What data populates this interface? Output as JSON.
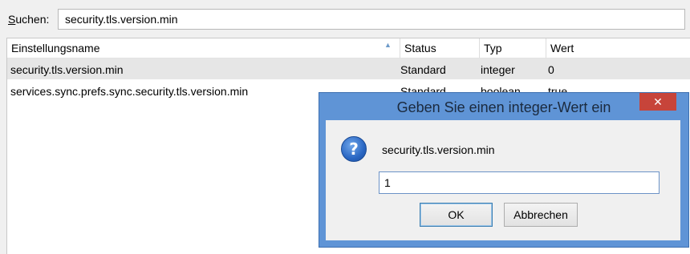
{
  "search": {
    "label_accel": "S",
    "label_rest": "uchen:",
    "value": "security.tls.version.min"
  },
  "table": {
    "columns": [
      "Einstellungsname",
      "Status",
      "Typ",
      "Wert"
    ],
    "rows": [
      {
        "name": "security.tls.version.min",
        "status": "Standard",
        "type": "integer",
        "value": "0"
      },
      {
        "name": "services.sync.prefs.sync.security.tls.version.min",
        "status": "Standard",
        "type": "boolean",
        "value": "true"
      }
    ]
  },
  "dialog": {
    "title": "Geben Sie einen integer-Wert ein",
    "close": "✕",
    "prompt": "security.tls.version.min",
    "input_value": "1",
    "ok_label": "OK",
    "cancel_label": "Abbrechen"
  },
  "icons": {
    "question": "?",
    "sort": "▲"
  },
  "colors": {
    "dialog_frame": "#5f94d6",
    "close_button": "#c7443a",
    "selected_row": "#e6e6e6"
  }
}
